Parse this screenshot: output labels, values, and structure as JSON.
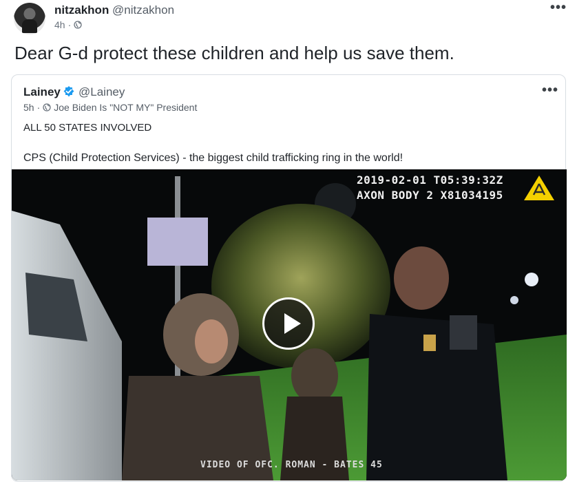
{
  "post": {
    "author_name": "nitzakhon",
    "author_handle": "@nitzakhon",
    "time": "4h",
    "separator": "·",
    "more_label": "•••",
    "text": "Dear G-d protect these children and help us save them."
  },
  "quote": {
    "author_name": "Lainey",
    "author_handle": "@Lainey",
    "time": "5h",
    "separator": "·",
    "display_suffix": "Joe Biden Is \"NOT MY\" President",
    "more_label": "•••",
    "line1": "ALL 50 STATES INVOLVED",
    "line2": "CPS (Child Protection Services) - the biggest child trafficking ring in the world!",
    "video": {
      "timestamp_line1": "2019-02-01 T05:39:32Z",
      "timestamp_line2": "AXON BODY 2 X81034195",
      "caption": "VIDEO OF OFC. ROMAN - BATES 45"
    }
  },
  "colors": {
    "verified": "#1d9bf0",
    "axon_yellow": "#f4d000",
    "grass": "#3f8a2c"
  }
}
